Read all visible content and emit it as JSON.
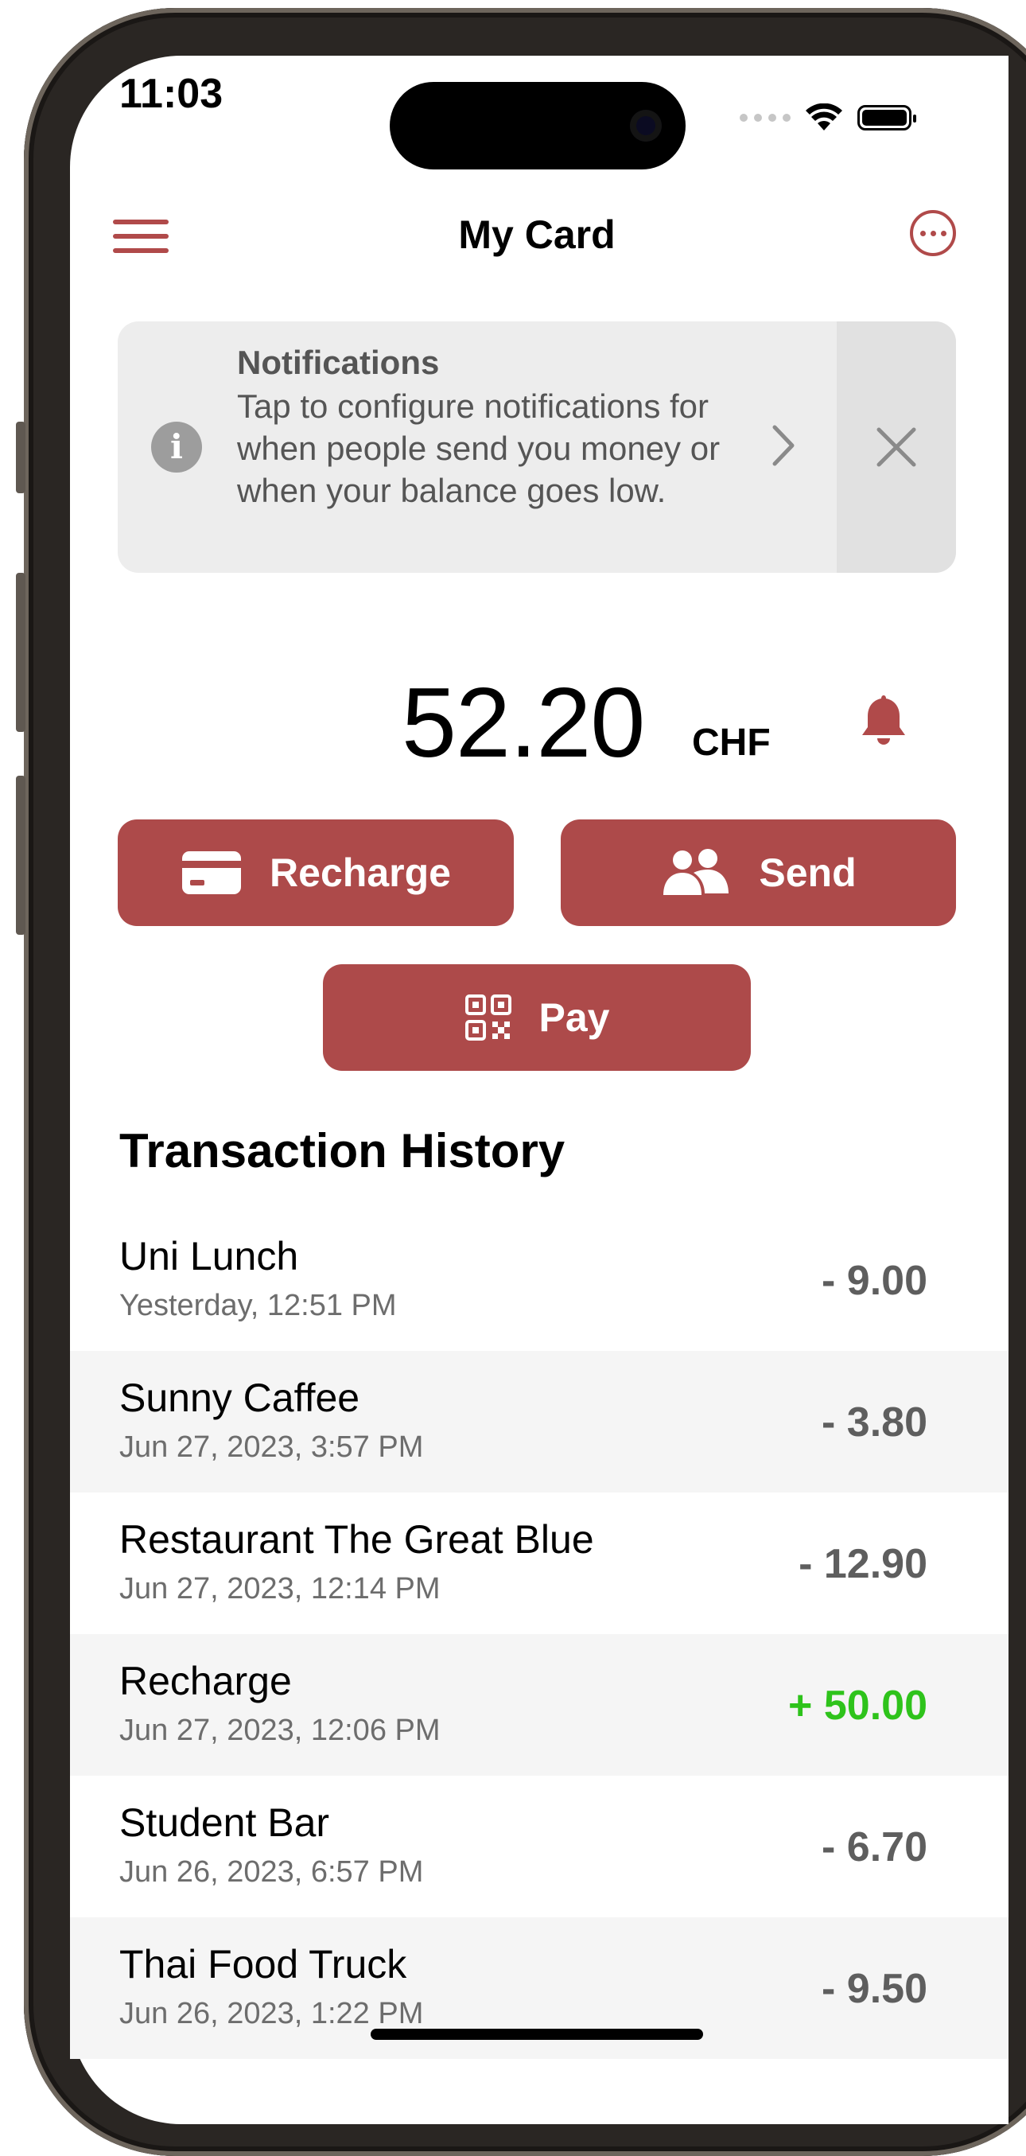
{
  "status_bar": {
    "time": "11:03"
  },
  "header": {
    "title": "My Card",
    "menu_icon": "hamburger-icon",
    "more_icon": "more-icon"
  },
  "notification_banner": {
    "title": "Notifications",
    "body": "Tap to configure notifications for when people send you money or when your balance goes low.",
    "info_icon": "info-icon",
    "chevron_icon": "chevron-right-icon",
    "close_icon": "close-icon"
  },
  "balance": {
    "amount": "52.20",
    "currency": "CHF",
    "alert_icon": "bell-icon"
  },
  "actions": {
    "recharge_label": "Recharge",
    "send_label": "Send",
    "pay_label": "Pay"
  },
  "history": {
    "title": "Transaction History",
    "transactions": [
      {
        "name": "Uni Lunch",
        "date": "Yesterday, 12:51 PM",
        "amount": "- 9.00"
      },
      {
        "name": "Sunny Caffee",
        "date": "Jun 27, 2023, 3:57 PM",
        "amount": "- 3.80"
      },
      {
        "name": "Restaurant The Great Blue",
        "date": "Jun 27, 2023, 12:14 PM",
        "amount": "- 12.90"
      },
      {
        "name": "Recharge",
        "date": "Jun 27, 2023, 12:06 PM",
        "amount": "+ 50.00"
      },
      {
        "name": "Student Bar",
        "date": "Jun 26, 2023, 6:57 PM",
        "amount": "- 6.70"
      },
      {
        "name": "Thai Food Truck",
        "date": "Jun 26, 2023, 1:22 PM",
        "amount": "- 9.50"
      }
    ]
  },
  "colors": {
    "accent": "#ad4a4a",
    "positive": "#2ec31b",
    "negative": "#5e5e5e",
    "banner_bg": "#ededed"
  }
}
